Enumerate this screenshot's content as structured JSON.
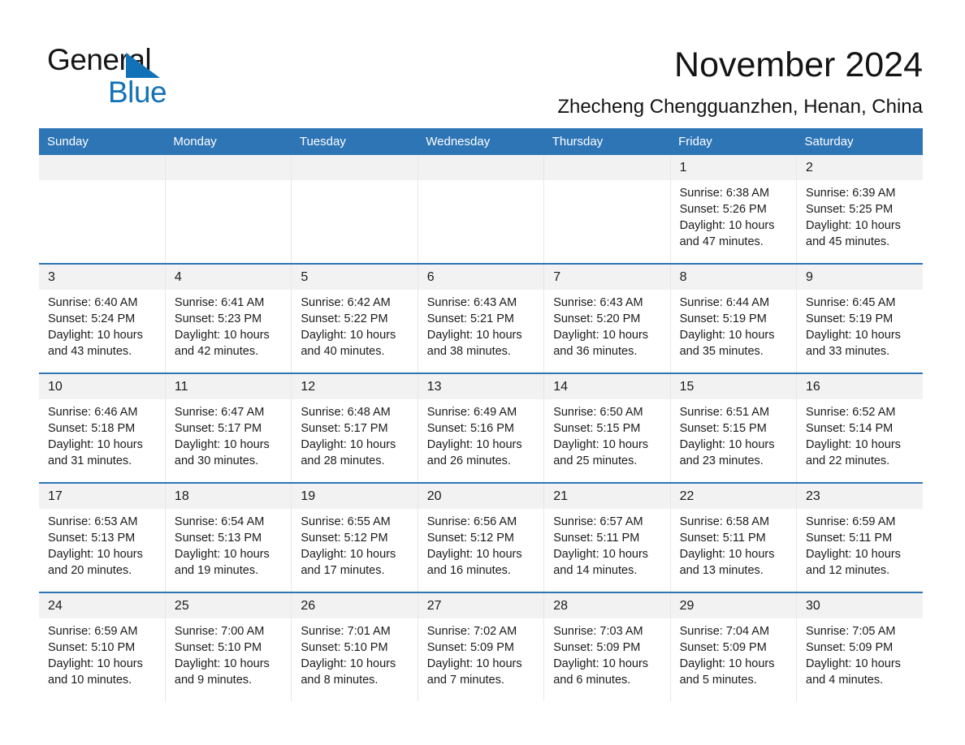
{
  "brand": {
    "name_part1": "General",
    "name_part2": "Blue",
    "triangle_color": "#1272B8"
  },
  "header": {
    "title": "November 2024",
    "subtitle": "Zhecheng Chengguanzhen, Henan, China",
    "accent_color": "#2E75B6",
    "daynum_band_color": "#F2F2F2"
  },
  "weekday_headers": [
    "Sunday",
    "Monday",
    "Tuesday",
    "Wednesday",
    "Thursday",
    "Friday",
    "Saturday"
  ],
  "labels": {
    "sunrise_prefix": "Sunrise:",
    "sunset_prefix": "Sunset:",
    "daylight_prefix": "Daylight:"
  },
  "weeks": [
    [
      {
        "day": "",
        "empty": true
      },
      {
        "day": "",
        "empty": true
      },
      {
        "day": "",
        "empty": true
      },
      {
        "day": "",
        "empty": true
      },
      {
        "day": "",
        "empty": true
      },
      {
        "day": "1",
        "sunrise": "Sunrise: 6:38 AM",
        "sunset": "Sunset: 5:26 PM",
        "daylight_line1": "Daylight: 10 hours",
        "daylight_line2": "and 47 minutes."
      },
      {
        "day": "2",
        "sunrise": "Sunrise: 6:39 AM",
        "sunset": "Sunset: 5:25 PM",
        "daylight_line1": "Daylight: 10 hours",
        "daylight_line2": "and 45 minutes."
      }
    ],
    [
      {
        "day": "3",
        "sunrise": "Sunrise: 6:40 AM",
        "sunset": "Sunset: 5:24 PM",
        "daylight_line1": "Daylight: 10 hours",
        "daylight_line2": "and 43 minutes."
      },
      {
        "day": "4",
        "sunrise": "Sunrise: 6:41 AM",
        "sunset": "Sunset: 5:23 PM",
        "daylight_line1": "Daylight: 10 hours",
        "daylight_line2": "and 42 minutes."
      },
      {
        "day": "5",
        "sunrise": "Sunrise: 6:42 AM",
        "sunset": "Sunset: 5:22 PM",
        "daylight_line1": "Daylight: 10 hours",
        "daylight_line2": "and 40 minutes."
      },
      {
        "day": "6",
        "sunrise": "Sunrise: 6:43 AM",
        "sunset": "Sunset: 5:21 PM",
        "daylight_line1": "Daylight: 10 hours",
        "daylight_line2": "and 38 minutes."
      },
      {
        "day": "7",
        "sunrise": "Sunrise: 6:43 AM",
        "sunset": "Sunset: 5:20 PM",
        "daylight_line1": "Daylight: 10 hours",
        "daylight_line2": "and 36 minutes."
      },
      {
        "day": "8",
        "sunrise": "Sunrise: 6:44 AM",
        "sunset": "Sunset: 5:19 PM",
        "daylight_line1": "Daylight: 10 hours",
        "daylight_line2": "and 35 minutes."
      },
      {
        "day": "9",
        "sunrise": "Sunrise: 6:45 AM",
        "sunset": "Sunset: 5:19 PM",
        "daylight_line1": "Daylight: 10 hours",
        "daylight_line2": "and 33 minutes."
      }
    ],
    [
      {
        "day": "10",
        "sunrise": "Sunrise: 6:46 AM",
        "sunset": "Sunset: 5:18 PM",
        "daylight_line1": "Daylight: 10 hours",
        "daylight_line2": "and 31 minutes."
      },
      {
        "day": "11",
        "sunrise": "Sunrise: 6:47 AM",
        "sunset": "Sunset: 5:17 PM",
        "daylight_line1": "Daylight: 10 hours",
        "daylight_line2": "and 30 minutes."
      },
      {
        "day": "12",
        "sunrise": "Sunrise: 6:48 AM",
        "sunset": "Sunset: 5:17 PM",
        "daylight_line1": "Daylight: 10 hours",
        "daylight_line2": "and 28 minutes."
      },
      {
        "day": "13",
        "sunrise": "Sunrise: 6:49 AM",
        "sunset": "Sunset: 5:16 PM",
        "daylight_line1": "Daylight: 10 hours",
        "daylight_line2": "and 26 minutes."
      },
      {
        "day": "14",
        "sunrise": "Sunrise: 6:50 AM",
        "sunset": "Sunset: 5:15 PM",
        "daylight_line1": "Daylight: 10 hours",
        "daylight_line2": "and 25 minutes."
      },
      {
        "day": "15",
        "sunrise": "Sunrise: 6:51 AM",
        "sunset": "Sunset: 5:15 PM",
        "daylight_line1": "Daylight: 10 hours",
        "daylight_line2": "and 23 minutes."
      },
      {
        "day": "16",
        "sunrise": "Sunrise: 6:52 AM",
        "sunset": "Sunset: 5:14 PM",
        "daylight_line1": "Daylight: 10 hours",
        "daylight_line2": "and 22 minutes."
      }
    ],
    [
      {
        "day": "17",
        "sunrise": "Sunrise: 6:53 AM",
        "sunset": "Sunset: 5:13 PM",
        "daylight_line1": "Daylight: 10 hours",
        "daylight_line2": "and 20 minutes."
      },
      {
        "day": "18",
        "sunrise": "Sunrise: 6:54 AM",
        "sunset": "Sunset: 5:13 PM",
        "daylight_line1": "Daylight: 10 hours",
        "daylight_line2": "and 19 minutes."
      },
      {
        "day": "19",
        "sunrise": "Sunrise: 6:55 AM",
        "sunset": "Sunset: 5:12 PM",
        "daylight_line1": "Daylight: 10 hours",
        "daylight_line2": "and 17 minutes."
      },
      {
        "day": "20",
        "sunrise": "Sunrise: 6:56 AM",
        "sunset": "Sunset: 5:12 PM",
        "daylight_line1": "Daylight: 10 hours",
        "daylight_line2": "and 16 minutes."
      },
      {
        "day": "21",
        "sunrise": "Sunrise: 6:57 AM",
        "sunset": "Sunset: 5:11 PM",
        "daylight_line1": "Daylight: 10 hours",
        "daylight_line2": "and 14 minutes."
      },
      {
        "day": "22",
        "sunrise": "Sunrise: 6:58 AM",
        "sunset": "Sunset: 5:11 PM",
        "daylight_line1": "Daylight: 10 hours",
        "daylight_line2": "and 13 minutes."
      },
      {
        "day": "23",
        "sunrise": "Sunrise: 6:59 AM",
        "sunset": "Sunset: 5:11 PM",
        "daylight_line1": "Daylight: 10 hours",
        "daylight_line2": "and 12 minutes."
      }
    ],
    [
      {
        "day": "24",
        "sunrise": "Sunrise: 6:59 AM",
        "sunset": "Sunset: 5:10 PM",
        "daylight_line1": "Daylight: 10 hours",
        "daylight_line2": "and 10 minutes."
      },
      {
        "day": "25",
        "sunrise": "Sunrise: 7:00 AM",
        "sunset": "Sunset: 5:10 PM",
        "daylight_line1": "Daylight: 10 hours",
        "daylight_line2": "and 9 minutes."
      },
      {
        "day": "26",
        "sunrise": "Sunrise: 7:01 AM",
        "sunset": "Sunset: 5:10 PM",
        "daylight_line1": "Daylight: 10 hours",
        "daylight_line2": "and 8 minutes."
      },
      {
        "day": "27",
        "sunrise": "Sunrise: 7:02 AM",
        "sunset": "Sunset: 5:09 PM",
        "daylight_line1": "Daylight: 10 hours",
        "daylight_line2": "and 7 minutes."
      },
      {
        "day": "28",
        "sunrise": "Sunrise: 7:03 AM",
        "sunset": "Sunset: 5:09 PM",
        "daylight_line1": "Daylight: 10 hours",
        "daylight_line2": "and 6 minutes."
      },
      {
        "day": "29",
        "sunrise": "Sunrise: 7:04 AM",
        "sunset": "Sunset: 5:09 PM",
        "daylight_line1": "Daylight: 10 hours",
        "daylight_line2": "and 5 minutes."
      },
      {
        "day": "30",
        "sunrise": "Sunrise: 7:05 AM",
        "sunset": "Sunset: 5:09 PM",
        "daylight_line1": "Daylight: 10 hours",
        "daylight_line2": "and 4 minutes."
      }
    ]
  ]
}
